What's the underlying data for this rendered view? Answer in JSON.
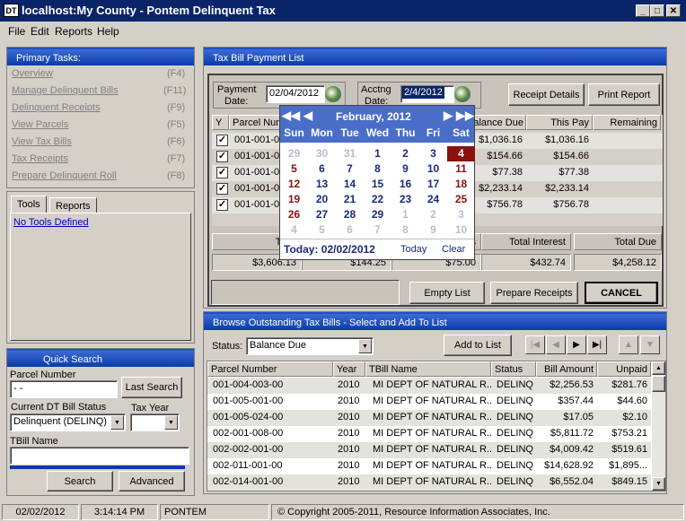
{
  "window": {
    "title": "localhost:My County - Pontem Delinquent Tax",
    "app_icon": "DT",
    "minimize": "_",
    "maximize": "□",
    "close": "✕"
  },
  "menu": [
    "File",
    "Edit",
    "Reports",
    "Help"
  ],
  "primary_tasks": {
    "title": "Primary Tasks:",
    "items": [
      {
        "label": "Overview",
        "key": "(F4)"
      },
      {
        "label": "Manage Delinquent Bills",
        "key": "(F11)"
      },
      {
        "label": "Delinquent Receipts",
        "key": "(F9)"
      },
      {
        "label": "View Parcels",
        "key": "(F5)"
      },
      {
        "label": "View Tax Bills",
        "key": "(F6)"
      },
      {
        "label": "Tax Receipts",
        "key": "(F7)"
      },
      {
        "label": "Prepare Delinquent Roll",
        "key": "(F8)"
      }
    ]
  },
  "tools": {
    "tabs": [
      "Tools",
      "Reports"
    ],
    "link": "No Tools Defined"
  },
  "quick_search": {
    "title": "Quick Search",
    "parcel_label": "Parcel Number",
    "parcel_value": "  -  -  ",
    "last_search": "Last Search",
    "status_label": "Current DT Bill Status",
    "status_value": "Delinquent (DELINQ)",
    "tax_year_label": "Tax Year",
    "tax_year_value": "",
    "tbill_label": "TBill Name",
    "tbill_value": "",
    "search": "Search",
    "advanced": "Advanced"
  },
  "payment": {
    "title": "Tax Bill Payment List",
    "payment_date_label_1": "Payment",
    "payment_date_label_2": "Date:",
    "payment_date": "02/04/2012",
    "acctng_label_1": "Acctng",
    "acctng_label_2": "Date:",
    "acctng_date": "2/4/2012",
    "receipt_details": "Receipt Details",
    "print_report": "Print Report",
    "columns": [
      "Y",
      "Parcel Num",
      "Balance Due",
      "This Pay",
      "Remaining"
    ],
    "rows": [
      {
        "parcel": "001-001-0",
        "balance": "$1,036.16",
        "this_pay": "$1,036.16"
      },
      {
        "parcel": "001-001-0",
        "balance": "$154.66",
        "this_pay": "$154.66"
      },
      {
        "parcel": "001-001-0",
        "balance": "$77.38",
        "this_pay": "$77.38"
      },
      {
        "parcel": "001-001-0",
        "balance": "$2,233.14",
        "this_pay": "$2,233.14"
      },
      {
        "parcel": "001-001-0",
        "balance": "$756.78",
        "this_pay": "$756.78"
      }
    ],
    "totals_headers": [
      "Total",
      "",
      "s",
      "Total Interest",
      "Total Due"
    ],
    "totals_values": [
      "$3,606.13",
      "$144.25",
      "$75.00",
      "$432.74",
      "$4,258.12"
    ],
    "empty_list": "Empty List",
    "prepare_receipts": "Prepare Receipts",
    "cancel": "CANCEL"
  },
  "calendar": {
    "month": "February, 2012",
    "days": [
      "Sun",
      "Mon",
      "Tue",
      "Wed",
      "Thu",
      "Fri",
      "Sat"
    ],
    "weeks": [
      [
        "29",
        "30",
        "31",
        "1",
        "2",
        "3",
        "4"
      ],
      [
        "5",
        "6",
        "7",
        "8",
        "9",
        "10",
        "11"
      ],
      [
        "12",
        "13",
        "14",
        "15",
        "16",
        "17",
        "18"
      ],
      [
        "19",
        "20",
        "21",
        "22",
        "23",
        "24",
        "25"
      ],
      [
        "26",
        "27",
        "28",
        "29",
        "1",
        "2",
        "3"
      ],
      [
        "4",
        "5",
        "6",
        "7",
        "8",
        "9",
        "10"
      ]
    ],
    "today_text": "Today: 02/02/2012",
    "today_btn": "Today",
    "clear_btn": "Clear"
  },
  "browse": {
    "title": "Browse Outstanding Tax Bills - Select and Add To List",
    "status_label": "Status:",
    "status_value": "Balance Due",
    "add_to_list": "Add to List",
    "columns": [
      "Parcel Number",
      "Year",
      "TBill Name",
      "Status",
      "Bill Amount",
      "Unpaid"
    ],
    "rows": [
      {
        "parcel": "001-004-003-00",
        "year": "2010",
        "name": "MI DEPT OF NATURAL R...",
        "status": "DELINQ",
        "amount": "$2,256.53",
        "unpaid": "$281.76"
      },
      {
        "parcel": "001-005-001-00",
        "year": "2010",
        "name": "MI DEPT OF NATURAL R...",
        "status": "DELINQ",
        "amount": "$357.44",
        "unpaid": "$44.60"
      },
      {
        "parcel": "001-005-024-00",
        "year": "2010",
        "name": "MI DEPT OF NATURAL R...",
        "status": "DELINQ",
        "amount": "$17.05",
        "unpaid": "$2.10"
      },
      {
        "parcel": "002-001-008-00",
        "year": "2010",
        "name": "MI DEPT OF NATURAL R...",
        "status": "DELINQ",
        "amount": "$5,811.72",
        "unpaid": "$753.21"
      },
      {
        "parcel": "002-002-001-00",
        "year": "2010",
        "name": "MI DEPT OF NATURAL R...",
        "status": "DELINQ",
        "amount": "$4,009.42",
        "unpaid": "$519.61"
      },
      {
        "parcel": "002-011-001-00",
        "year": "2010",
        "name": "MI DEPT OF NATURAL R...",
        "status": "DELINQ",
        "amount": "$14,628.92",
        "unpaid": "$1,895..."
      },
      {
        "parcel": "002-014-001-00",
        "year": "2010",
        "name": "MI DEPT OF NATURAL R...",
        "status": "DELINQ",
        "amount": "$6,552.04",
        "unpaid": "$849.15"
      }
    ]
  },
  "status_bar": {
    "date": "02/02/2012",
    "time": "3:14:14 PM",
    "user": "PONTEM",
    "copyright": "© Copyright 2005-2011, Resource Information Associates, Inc."
  },
  "colors": {
    "titlebar": "#0a246a",
    "panel_header": "#2a5ac8",
    "calendar_header": "#4a6ec8",
    "selected_day": "#8b1010"
  }
}
